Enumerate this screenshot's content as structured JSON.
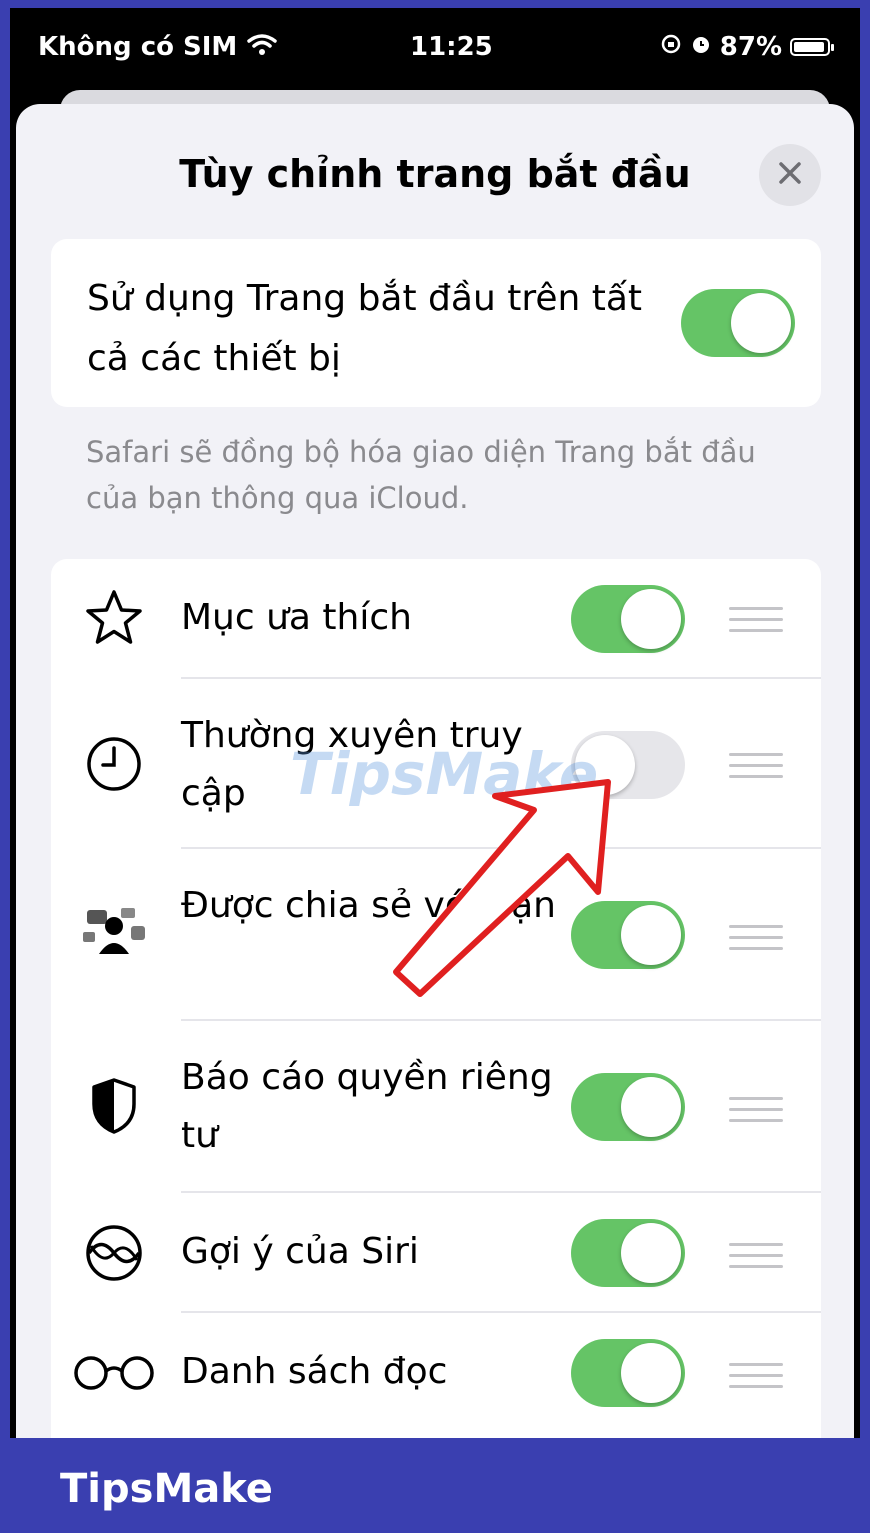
{
  "status_bar": {
    "carrier": "Không có SIM",
    "time": "11:25",
    "battery": "87%",
    "icons": [
      "wifi-icon",
      "orientation-lock-icon",
      "alarm-icon",
      "battery-icon"
    ]
  },
  "sheet": {
    "title": "Tùy chỉnh trang bắt đầu",
    "close_icon": "close-icon"
  },
  "sync": {
    "label": "Sử dụng Trang bắt đầu trên tất cả các thiết bị",
    "enabled": true,
    "footnote": "Safari sẽ đồng bộ hóa giao diện Trang bắt đầu của bạn thông qua iCloud."
  },
  "sections": [
    {
      "icon": "star-icon",
      "label": "Mục ưa thích",
      "enabled": true
    },
    {
      "icon": "clock-icon",
      "label": "Thường xuyên truy cập",
      "enabled": false
    },
    {
      "icon": "shared-with-you-icon",
      "label": "Được chia sẻ với bạn",
      "enabled": true
    },
    {
      "icon": "privacy-shield-icon",
      "label": "Báo cáo quyền riêng tư",
      "enabled": true
    },
    {
      "icon": "siri-icon",
      "label": "Gợi ý của Siri",
      "enabled": true
    },
    {
      "icon": "glasses-icon",
      "label": "Danh sách đọc",
      "enabled": true
    }
  ],
  "overlay": {
    "watermark_text": "TipsMake",
    "arrow_color": "#e02020"
  },
  "footer": {
    "brand": "TipsMake"
  },
  "colors": {
    "toggle_on": "#65c466",
    "toggle_off": "#e6e6ea",
    "brand_bar": "#3a3fb0"
  }
}
